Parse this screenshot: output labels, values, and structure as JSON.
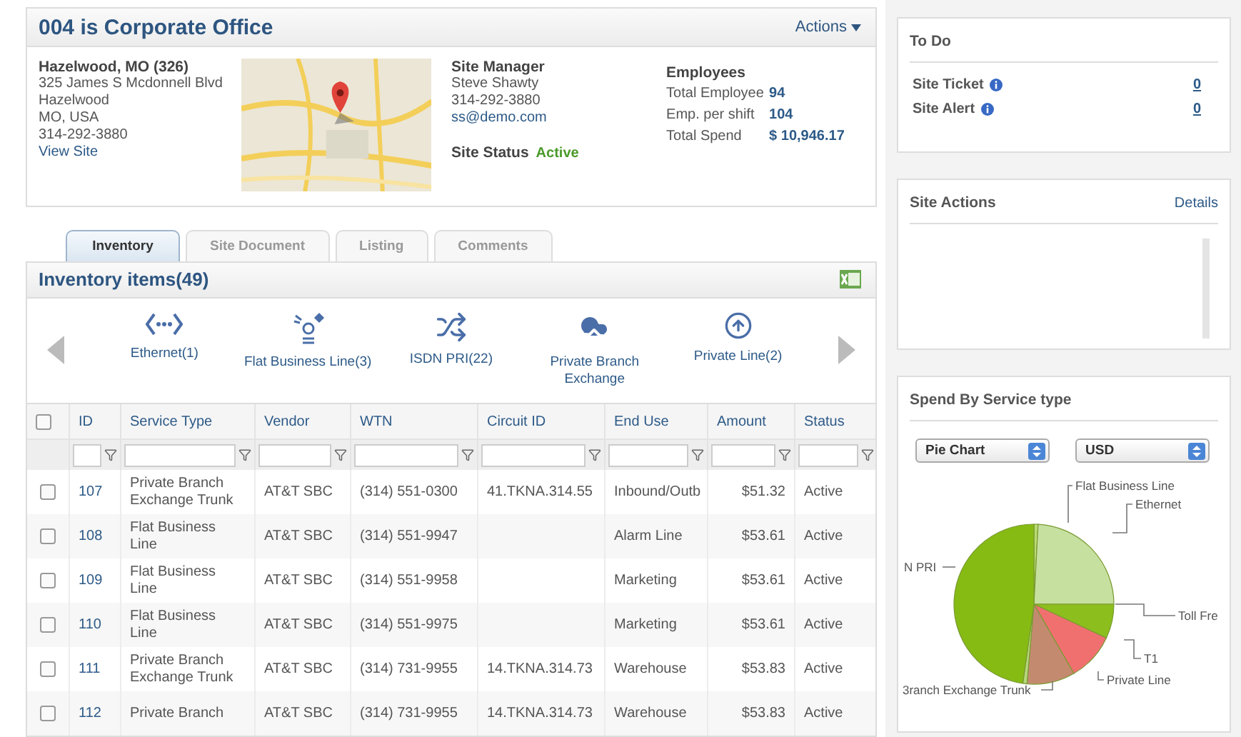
{
  "site": {
    "title": "004 is Corporate Office",
    "actions": "Actions",
    "address": {
      "heading": "Hazelwood, MO (326)",
      "lines": [
        "325 James S Mcdonnell Blvd",
        "Hazelwood",
        "MO, USA",
        "314-292-3880"
      ],
      "link": "View Site"
    },
    "manager": {
      "heading": "Site Manager",
      "name": "Steve Shawty",
      "phone": "314-292-3880",
      "email": "ss@demo.com",
      "status_label": "Site Status",
      "status": "Active"
    },
    "employees": {
      "heading": "Employees",
      "rows": [
        {
          "label": "Total Employee",
          "value": "94"
        },
        {
          "label": "Emp. per shift",
          "value": "104"
        },
        {
          "label": "Total Spend",
          "value": "$ 10,946.17"
        }
      ]
    }
  },
  "tabs": [
    {
      "label": "Inventory",
      "selected": true
    },
    {
      "label": "Site Document",
      "selected": false
    },
    {
      "label": "Listing",
      "selected": false
    },
    {
      "label": "Comments",
      "selected": false
    }
  ],
  "inventory": {
    "title": "Inventory items(49)",
    "categories": [
      "Ethernet(1)",
      "Flat Business Line(3)",
      "ISDN PRI(22)",
      "Private Branch Exchange",
      "Private Line(2)"
    ],
    "table": {
      "all_checked": false,
      "columns": [
        "ID",
        "Service Type",
        "Vendor",
        "WTN",
        "Circuit ID",
        "End Use",
        "Amount",
        "Status"
      ],
      "rows": [
        {
          "checked": false,
          "cells": [
            "107",
            "Private Branch Exchange Trunk",
            "AT&T SBC",
            "(314) 551-0300",
            "41.TKNA.314.55",
            "Inbound/Outb",
            "$51.32",
            "Active"
          ]
        },
        {
          "checked": false,
          "cells": [
            "108",
            "Flat Business Line",
            "AT&T SBC",
            "(314) 551-9947",
            "",
            "Alarm Line",
            "$53.61",
            "Active"
          ]
        },
        {
          "checked": false,
          "cells": [
            "109",
            "Flat Business Line",
            "AT&T SBC",
            "(314) 551-9958",
            "",
            "Marketing",
            "$53.61",
            "Active"
          ]
        },
        {
          "checked": false,
          "cells": [
            "110",
            "Flat Business Line",
            "AT&T SBC",
            "(314) 551-9975",
            "",
            "Marketing",
            "$53.61",
            "Active"
          ]
        },
        {
          "checked": false,
          "cells": [
            "111",
            "Private Branch Exchange Trunk",
            "AT&T SBC",
            "(314) 731-9955",
            "14.TKNA.314.73",
            "Warehouse",
            "$53.83",
            "Active"
          ]
        },
        {
          "checked": false,
          "cells": [
            "112",
            "Private Branch",
            "AT&T SBC",
            "(314) 731-9955",
            "14.TKNA.314.73",
            "Warehouse",
            "$53.83",
            "Active"
          ]
        }
      ]
    }
  },
  "todo": {
    "title": "To Do",
    "items": [
      {
        "label": "Site Ticket",
        "count": "0"
      },
      {
        "label": "Site Alert",
        "count": "0"
      }
    ]
  },
  "site_actions": {
    "title": "Site Actions",
    "link": "Details"
  },
  "spend": {
    "title": "Spend By Service type",
    "selects": [
      "Pie Chart",
      "USD"
    ],
    "slice_labels": [
      "Flat Business Line",
      "Ethernet",
      "N PRI",
      "Toll Fre",
      "T1",
      "Private Line",
      "3ranch Exchange Trunk"
    ]
  }
}
